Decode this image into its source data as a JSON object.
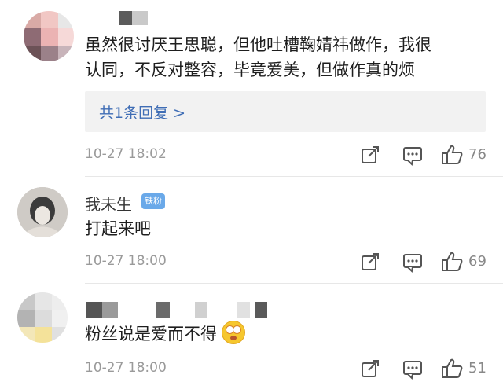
{
  "comments": [
    {
      "username": "",
      "text_lines": [
        "虽然很讨厌王思聪，但他吐槽鞠婧祎做作，我很",
        "认同，不反对整容，毕竟爱美，但做作真的烦"
      ],
      "reply_label": "共1条回复 >",
      "time": "10-27 18:02",
      "likes": "76"
    },
    {
      "username": "我未生",
      "badge": "铁粉",
      "text_lines": [
        "打起来吧"
      ],
      "time": "10-27 18:00",
      "likes": "69"
    },
    {
      "username": "",
      "text_lines": [
        "粉丝说是爱而不得"
      ],
      "time": "10-27 18:00",
      "likes": "51",
      "emoji": "astonished-face-emoji"
    }
  ],
  "icons": {
    "share": "share-icon",
    "comment": "comment-icon",
    "like": "thumbs-up-icon"
  },
  "colors": {
    "reply_link": "#3f6db5",
    "badge": "#6aa9e9",
    "muted_text": "#9a9a9a",
    "reply_bg": "#f2f2f2"
  }
}
